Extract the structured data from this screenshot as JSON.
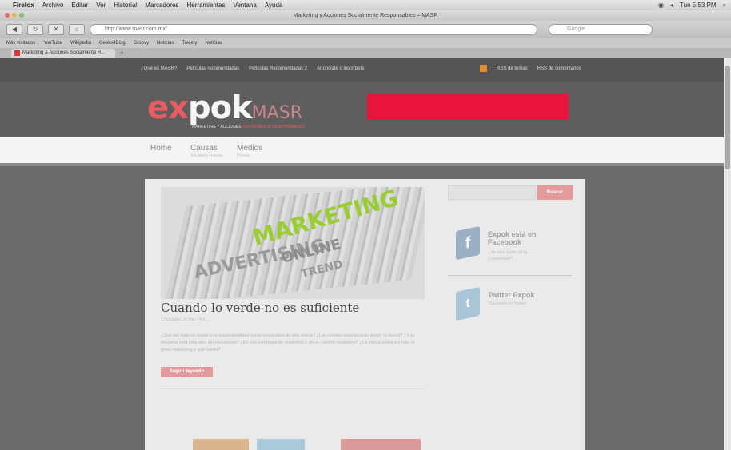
{
  "os_menubar": {
    "items": [
      "Firefox",
      "Archivo",
      "Editar",
      "Ver",
      "Historial",
      "Marcadores",
      "Herramientas",
      "Ventana",
      "Ayuda"
    ],
    "clock": "Tue 5:53 PM"
  },
  "window": {
    "title": "Marketing y Acciones Socialmente Responsables – MASR"
  },
  "browser": {
    "url": "http://www.masr.com.mx/",
    "search_placeholder": "Google",
    "bookmarks": [
      "Más visitados",
      "YouTube",
      "Wikipedia",
      "Geeks4Blog",
      "Groovy",
      "Noticias",
      "Tweety",
      "Noticias"
    ],
    "tab_title": "Marketing & Acciones Socialmente R...",
    "newtab_label": "+"
  },
  "site": {
    "top_links": [
      "¿Qué es MASR?",
      "Películas recomendadas",
      "Películas Recomendadas 2",
      "Anúnciate o inscríbete"
    ],
    "rss_links": [
      "RSS de temas",
      "RSS de comentarios"
    ],
    "logo": {
      "ex": "ex",
      "pok": "pok",
      "k": "",
      "masr": "MASR"
    },
    "tagline": {
      "main": "MARKETING Y ACCIONES",
      "accent": "SOCIALMENTE RESPONSABLES"
    },
    "nav": [
      {
        "label": "Home",
        "sub": ""
      },
      {
        "label": "Causas",
        "sub": "Sociales y marcas"
      },
      {
        "label": "Medios",
        "sub": "Prensa"
      }
    ],
    "hero_words": {
      "marketing": "MARKETING",
      "advertising": "ADVERTISING",
      "online": "ONLINE",
      "trend": "TREND"
    },
    "post": {
      "title": "Cuando lo verde no es suficiente",
      "meta": "17 Octubre, 10 Mar • Por ...",
      "excerpt": "¿Qué tan lejos se puede ir la responsabilidad social corporativa de una marca? ¿Los clientes reaccionarán mejor, tu tienda? ¿Y tu empresa está lista para ser reconocida? ¿Es una estrategia de marketing y de un cambio verdadero? ¿La marca podrá ser más el green marketing y qué medio?",
      "readmore": "Seguir leyendo"
    },
    "sidebar": {
      "search_button": "Buscar",
      "facebook": {
        "title": "Expok está en Facebook",
        "sub": "¿Ya eres parte de la Comunidad?"
      },
      "twitter": {
        "title": "Twitter Expok",
        "sub": "Síguenos en Twitter"
      }
    }
  }
}
